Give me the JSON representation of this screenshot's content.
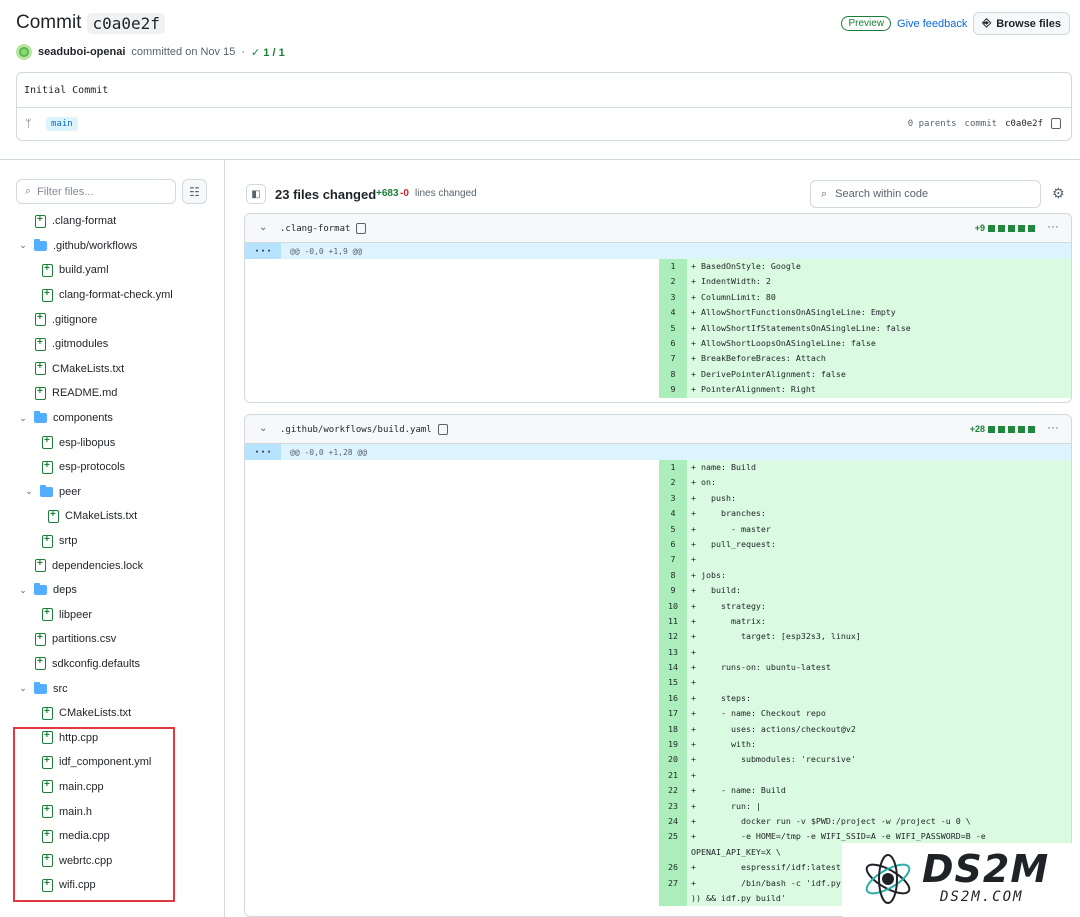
{
  "header": {
    "title_prefix": "Commit",
    "sha": "c0a0e2f",
    "author": "seaduboi-openai",
    "committed": "committed on Nov 15",
    "sep": "·",
    "checks": "✓ 1 / 1",
    "preview": "Preview",
    "feedback": "Give feedback",
    "browse": "Browse files"
  },
  "commit": {
    "message": "Initial Commit",
    "branch": "main",
    "parents": "0 parents",
    "commit_label": "commit",
    "commit_sha": "c0a0e2f"
  },
  "sidebar": {
    "filter_placeholder": "Filter files...",
    "items": [
      {
        "type": "file",
        "depth": 1,
        "name": ".clang-format"
      },
      {
        "type": "folder",
        "depth": 0,
        "name": ".github/workflows"
      },
      {
        "type": "file",
        "depth": 2,
        "name": "build.yaml"
      },
      {
        "type": "file",
        "depth": 2,
        "name": "clang-format-check.yml"
      },
      {
        "type": "file",
        "depth": 1,
        "name": ".gitignore"
      },
      {
        "type": "file",
        "depth": 1,
        "name": ".gitmodules"
      },
      {
        "type": "file",
        "depth": 1,
        "name": "CMakeLists.txt"
      },
      {
        "type": "file",
        "depth": 1,
        "name": "README.md"
      },
      {
        "type": "folder",
        "depth": 0,
        "name": "components"
      },
      {
        "type": "file",
        "depth": 2,
        "name": "esp-libopus"
      },
      {
        "type": "file",
        "depth": 2,
        "name": "esp-protocols"
      },
      {
        "type": "folder",
        "depth": 1,
        "name": "peer"
      },
      {
        "type": "file",
        "depth": 3,
        "name": "CMakeLists.txt"
      },
      {
        "type": "file",
        "depth": 2,
        "name": "srtp"
      },
      {
        "type": "file",
        "depth": 1,
        "name": "dependencies.lock"
      },
      {
        "type": "folder",
        "depth": 0,
        "name": "deps"
      },
      {
        "type": "file",
        "depth": 2,
        "name": "libpeer"
      },
      {
        "type": "file",
        "depth": 1,
        "name": "partitions.csv"
      },
      {
        "type": "file",
        "depth": 1,
        "name": "sdkconfig.defaults"
      },
      {
        "type": "folder",
        "depth": 0,
        "name": "src"
      },
      {
        "type": "file",
        "depth": 2,
        "name": "CMakeLists.txt"
      },
      {
        "type": "file",
        "depth": 2,
        "name": "http.cpp"
      },
      {
        "type": "file",
        "depth": 2,
        "name": "idf_component.yml"
      },
      {
        "type": "file",
        "depth": 2,
        "name": "main.cpp"
      },
      {
        "type": "file",
        "depth": 2,
        "name": "main.h"
      },
      {
        "type": "file",
        "depth": 2,
        "name": "media.cpp"
      },
      {
        "type": "file",
        "depth": 2,
        "name": "webrtc.cpp"
      },
      {
        "type": "file",
        "depth": 2,
        "name": "wifi.cpp"
      }
    ]
  },
  "main": {
    "files_changed": "23 files changed",
    "additions": "+683",
    "deletions": "-0",
    "lines_changed": "lines changed",
    "search_placeholder": "Search within code"
  },
  "diffs": [
    {
      "file": ".clang-format",
      "stat": "+9",
      "hunk": "@@ -0,0 +1,9 @@",
      "lines": [
        {
          "n": "1",
          "t": "+ BasedOnStyle: Google"
        },
        {
          "n": "2",
          "t": "+ IndentWidth: 2"
        },
        {
          "n": "3",
          "t": "+ ColumnLimit: 80"
        },
        {
          "n": "4",
          "t": "+ AllowShortFunctionsOnASingleLine: Empty"
        },
        {
          "n": "5",
          "t": "+ AllowShortIfStatementsOnASingleLine: false"
        },
        {
          "n": "6",
          "t": "+ AllowShortLoopsOnASingleLine: false"
        },
        {
          "n": "7",
          "t": "+ BreakBeforeBraces: Attach"
        },
        {
          "n": "8",
          "t": "+ DerivePointerAlignment: false"
        },
        {
          "n": "9",
          "t": "+ PointerAlignment: Right"
        }
      ]
    },
    {
      "file": ".github/workflows/build.yaml",
      "stat": "+28",
      "hunk": "@@ -0,0 +1,28 @@",
      "lines": [
        {
          "n": "1",
          "t": "+ name: Build"
        },
        {
          "n": "2",
          "t": "+ on:"
        },
        {
          "n": "3",
          "t": "+   push:"
        },
        {
          "n": "4",
          "t": "+     branches:"
        },
        {
          "n": "5",
          "t": "+       - master"
        },
        {
          "n": "6",
          "t": "+   pull_request:"
        },
        {
          "n": "7",
          "t": "+"
        },
        {
          "n": "8",
          "t": "+ jobs:"
        },
        {
          "n": "9",
          "t": "+   build:"
        },
        {
          "n": "10",
          "t": "+     strategy:"
        },
        {
          "n": "11",
          "t": "+       matrix:"
        },
        {
          "n": "12",
          "t": "+         target: [esp32s3, linux]"
        },
        {
          "n": "13",
          "t": "+"
        },
        {
          "n": "14",
          "t": "+     runs-on: ubuntu-latest"
        },
        {
          "n": "15",
          "t": "+"
        },
        {
          "n": "16",
          "t": "+     steps:"
        },
        {
          "n": "17",
          "t": "+     - name: Checkout repo"
        },
        {
          "n": "18",
          "t": "+       uses: actions/checkout@v2"
        },
        {
          "n": "19",
          "t": "+       with:"
        },
        {
          "n": "20",
          "t": "+         submodules: 'recursive'"
        },
        {
          "n": "21",
          "t": "+"
        },
        {
          "n": "22",
          "t": "+     - name: Build"
        },
        {
          "n": "23",
          "t": "+       run: |"
        },
        {
          "n": "24",
          "t": "+         docker run -v $PWD:/project -w /project -u 0 \\"
        },
        {
          "n": "25",
          "t": "+         -e HOME=/tmp -e WIFI_SSID=A -e WIFI_PASSWORD=B -e"
        },
        {
          "n": "",
          "t": "OPENAI_API_KEY=X \\"
        },
        {
          "n": "26",
          "t": "+         espressif/idf:latest"
        },
        {
          "n": "27",
          "t": "+         /bin/bash -c 'idf.py"
        },
        {
          "n": "",
          "t": ")) && idf.py build'"
        }
      ]
    }
  ],
  "watermark": {
    "big": "DS2M",
    "small": "DS2M.COM"
  }
}
